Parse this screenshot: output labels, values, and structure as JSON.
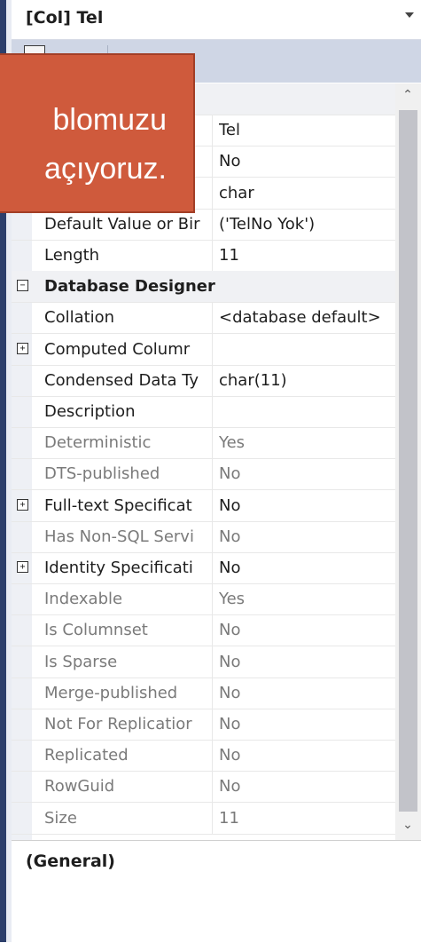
{
  "header": {
    "title": "[Col] Tel"
  },
  "callout": {
    "line1": "blomuzu",
    "line2": "açıyoruz."
  },
  "rows": [
    {
      "name": "",
      "value": "",
      "type": "category-hidden"
    },
    {
      "name": "",
      "value": "Tel",
      "type": "prop"
    },
    {
      "name": "",
      "value": "No",
      "type": "prop"
    },
    {
      "name": "",
      "value": "char",
      "type": "prop"
    },
    {
      "name": "Default Value or Bir",
      "value": "('TelNo Yok')",
      "type": "prop"
    },
    {
      "name": "Length",
      "value": "11",
      "type": "prop"
    },
    {
      "name": "Database Designer",
      "value": "",
      "type": "category",
      "expander": "⊟"
    },
    {
      "name": "Collation",
      "value": "<database default>",
      "type": "prop"
    },
    {
      "name": "Computed Columr",
      "value": "",
      "type": "prop",
      "expander": "⊞"
    },
    {
      "name": "Condensed Data Ty",
      "value": "char(11)",
      "type": "prop"
    },
    {
      "name": "Description",
      "value": "",
      "type": "prop"
    },
    {
      "name": "Deterministic",
      "value": "Yes",
      "type": "disabled"
    },
    {
      "name": "DTS-published",
      "value": "No",
      "type": "disabled"
    },
    {
      "name": "Full-text Specificat",
      "value": "No",
      "type": "prop",
      "expander": "⊞"
    },
    {
      "name": "Has Non-SQL Servi",
      "value": "No",
      "type": "disabled"
    },
    {
      "name": "Identity Specificati",
      "value": "No",
      "type": "prop",
      "expander": "⊞"
    },
    {
      "name": "Indexable",
      "value": "Yes",
      "type": "disabled"
    },
    {
      "name": "Is Columnset",
      "value": "No",
      "type": "disabled"
    },
    {
      "name": "Is Sparse",
      "value": "No",
      "type": "disabled"
    },
    {
      "name": "Merge-published",
      "value": "No",
      "type": "disabled"
    },
    {
      "name": "Not For Replicatior",
      "value": "No",
      "type": "disabled"
    },
    {
      "name": "Replicated",
      "value": "No",
      "type": "disabled"
    },
    {
      "name": "RowGuid",
      "value": "No",
      "type": "disabled"
    },
    {
      "name": "Size",
      "value": "11",
      "type": "disabled"
    }
  ],
  "footer": {
    "category": "(General)"
  },
  "icons": {
    "scroll_up": "chevron-up-icon",
    "scroll_down": "chevron-down-icon",
    "dropdown": "dropdown-arrow-icon"
  }
}
